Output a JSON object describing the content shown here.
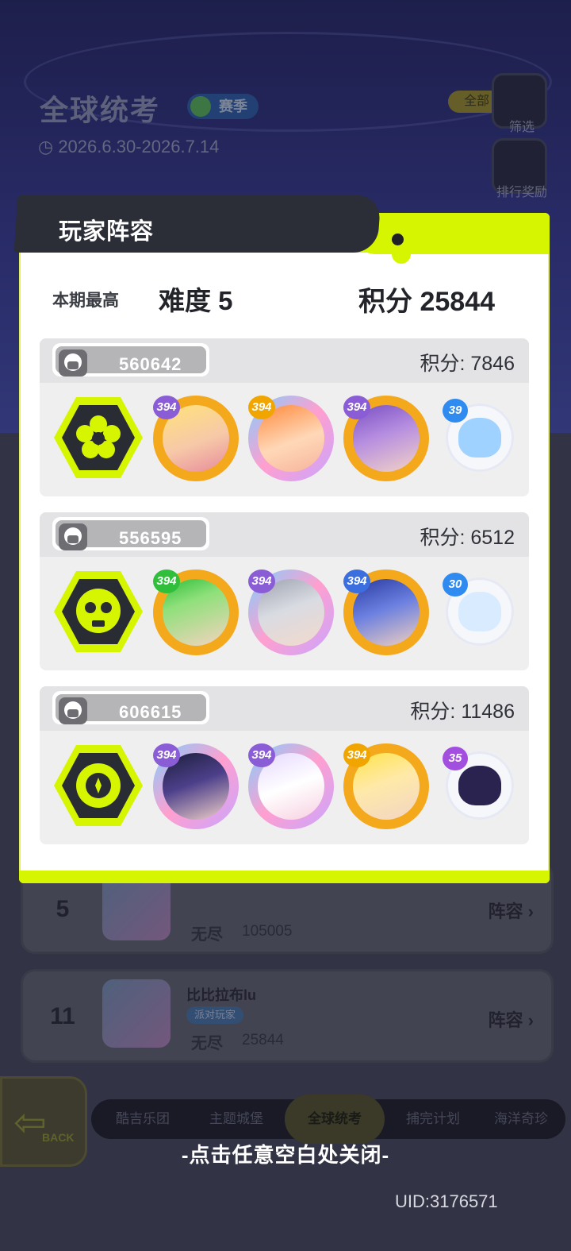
{
  "background": {
    "title": "全球统考",
    "season_label": "赛季",
    "date_range": "2026.6.30-2026.7.14",
    "filter_chip": "全部",
    "filter_label": "筛选",
    "rank_reward_label": "排行奖励",
    "rank_rows": [
      {
        "rank": "5",
        "name": "",
        "mode": "无尽",
        "score": "105005",
        "action": "阵容"
      },
      {
        "rank": "11",
        "name": "比比拉布lu",
        "tag": "派对玩家",
        "mode": "无尽",
        "score": "25844",
        "action": "阵容"
      }
    ],
    "back_label": "BACK",
    "tabs": [
      "酷吉乐团",
      "主题城堡",
      "全球统考",
      "捕完计划",
      "海洋奇珍"
    ],
    "active_tab": "全球统考"
  },
  "modal": {
    "title": "玩家阵容",
    "best_label": "本期最高",
    "best_difficulty": "难度 5",
    "best_score": "积分 25844",
    "accent_color": "#d6f500",
    "teams": [
      {
        "id": "560642",
        "score_label": "积分",
        "score": "7846",
        "emblem": "flower-emblem",
        "heroes": [
          {
            "level": "394"
          },
          {
            "level": "394"
          },
          {
            "level": "394"
          }
        ],
        "pet_level": "39",
        "pet_color": "#2f8bf0"
      },
      {
        "id": "556595",
        "score_label": "积分",
        "score": "6512",
        "emblem": "skull-emblem",
        "heroes": [
          {
            "level": "394"
          },
          {
            "level": "394"
          },
          {
            "level": "394"
          }
        ],
        "pet_level": "30",
        "pet_color": "#2f8bf0"
      },
      {
        "id": "606615",
        "score_label": "积分",
        "score": "11486",
        "emblem": "gear-emblem",
        "heroes": [
          {
            "level": "394"
          },
          {
            "level": "394"
          },
          {
            "level": "394"
          }
        ],
        "pet_level": "35",
        "pet_color": "#a24fe0"
      }
    ]
  },
  "close_hint": "-点击任意空白处关闭-",
  "uid": "UID:3176571"
}
